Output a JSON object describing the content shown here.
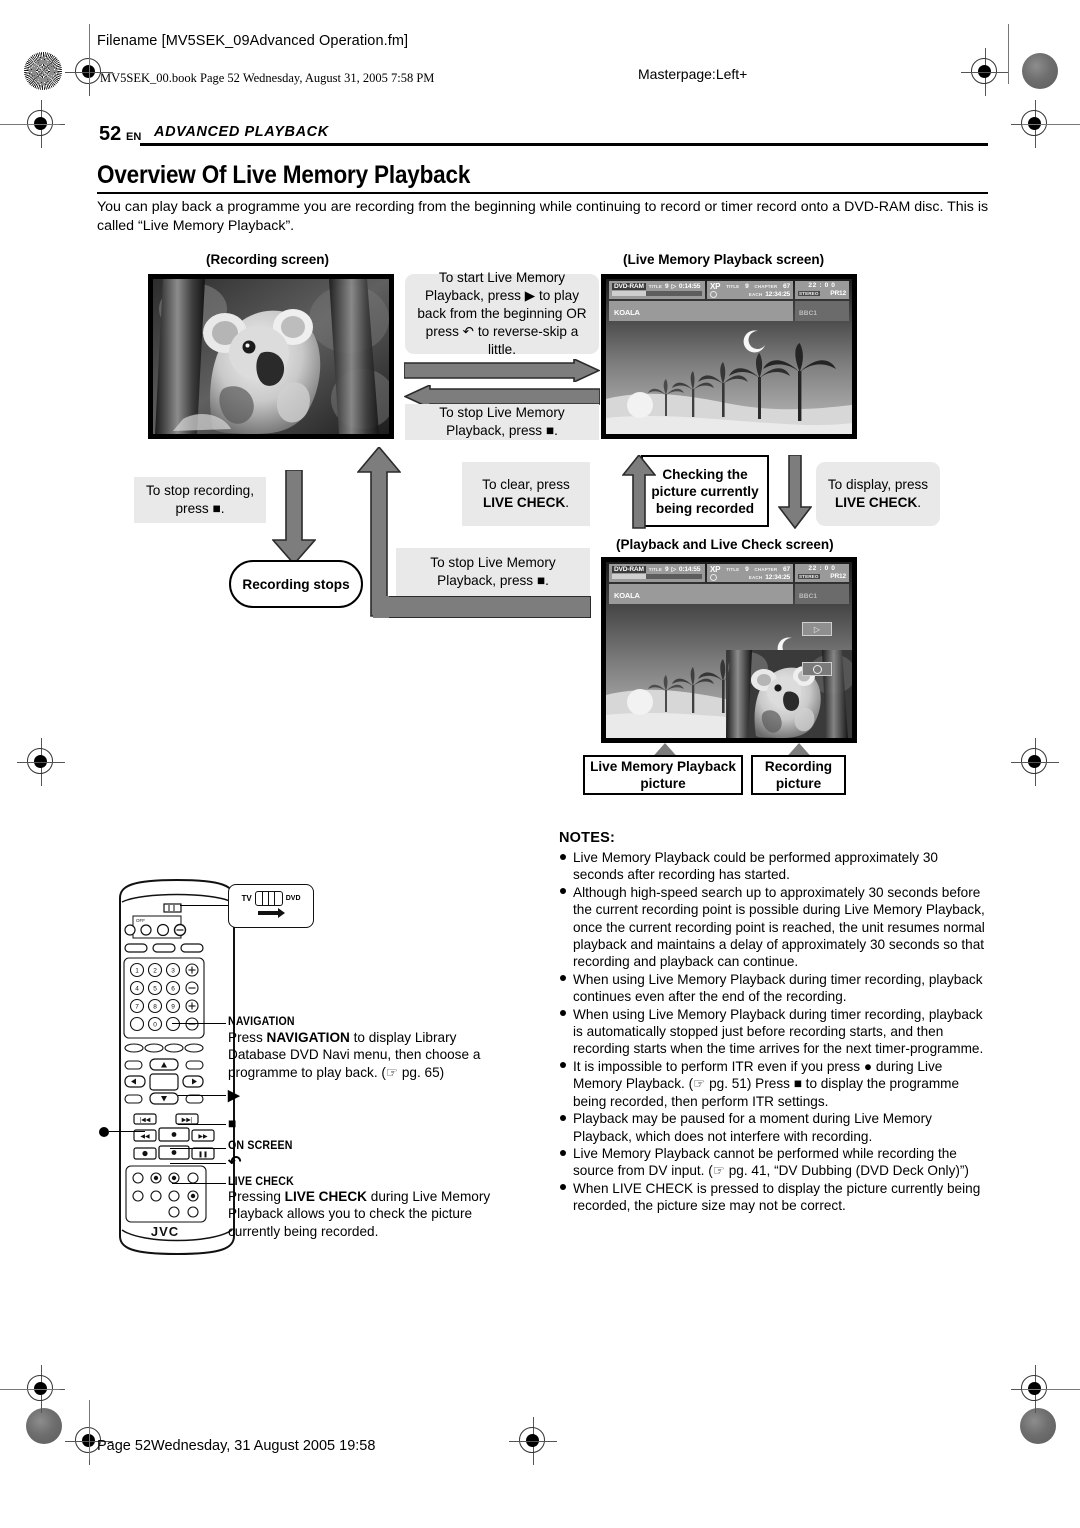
{
  "header": {
    "filename": "Filename [MV5SEK_09Advanced Operation.fm]",
    "bookline": "MV5SEK_00.book  Page 52  Wednesday, August 31, 2005  7:58 PM",
    "masterpage": "Masterpage:Left+"
  },
  "running_head": {
    "page_number": "52",
    "lang": "EN",
    "section": "ADVANCED PLAYBACK"
  },
  "title": "Overview Of Live Memory Playback",
  "intro": "You can play back a programme you are recording from the beginning while continuing to record or timer record onto a DVD-RAM disc. This is called “Live Memory Playback”.",
  "diagram": {
    "recording_screen_caption": "(Recording screen)",
    "live_memory_caption": "(Live Memory Playback screen)",
    "playback_livecheck_caption": "(Playback and Live Check screen)",
    "box_start": "To start Live Memory Playback, press ▶ to play back from the beginning OR press ↶ to reverse-skip a little.",
    "box_stop_lmp_top": "To stop Live Memory Playback, press ■.",
    "box_stop_recording": "To stop recording, press ■.",
    "box_recording_stops": "Recording stops",
    "box_stop_lmp_bottom": "To stop Live Memory Playback, press ■.",
    "box_clear": "To clear, press",
    "box_clear_bold": "LIVE CHECK",
    "box_clear_tail": ".",
    "box_checking": "Checking the picture currently being recorded",
    "box_display": "To display, press",
    "box_display_bold": "LIVE CHECK",
    "box_display_tail": ".",
    "label_lmp_picture": "Live Memory Playback picture",
    "label_recording_picture": "Recording picture"
  },
  "osd": {
    "disc": "DVD-RAM",
    "title_label": "TITLE",
    "title_value": "9",
    "time_elapsed": "0:14:55",
    "rec_mode": "XP",
    "title2_label": "TITLE",
    "title2_value": "9",
    "chapter_label": "CHAPTER",
    "chapter_value": "67",
    "each_label": "EACH",
    "each_value": "12:34:25",
    "clock": "22 : 0 0",
    "audio": "STEREO",
    "programme": "PR12",
    "disc_name": "KOALA",
    "channel": "BBC1"
  },
  "notes": {
    "heading": "NOTES:",
    "items": [
      "Live Memory Playback could be performed approximately 30 seconds after recording has started.",
      "Although high-speed search up to approximately 30 seconds before the current recording point is possible during Live Memory Playback, once the current recording point is reached, the unit resumes normal playback and maintains a delay of approximately 30 seconds so that recording and playback can continue.",
      "When using Live Memory Playback during timer recording, playback continues even after the end of the recording.",
      "When using Live Memory Playback during timer recording, playback is automatically stopped just before recording starts, and then recording starts when the time arrives for the next timer-programme.",
      "It is impossible to perform ITR even if you press ● during Live Memory Playback. (☞ pg. 51) Press ■ to display the programme being recorded, then perform ITR settings.",
      "Playback may be paused for a moment during Live Memory Playback, which does not interfere with recording.",
      "Live Memory Playback cannot be performed while recording the source from DV input. (☞ pg. 41, “DV Dubbing (DVD Deck Only)”)",
      "When LIVE CHECK is pressed to display the picture currently being recorded, the picture size may not be correct."
    ]
  },
  "remote": {
    "brand": "JVC",
    "tv_label": "TV",
    "dvd_label": "DVD",
    "off_label": "OFF",
    "keypad": [
      "1",
      "2",
      "3",
      "4",
      "5",
      "6",
      "7",
      "8",
      "9",
      "0"
    ],
    "navigation_title": "NAVIGATION",
    "navigation_text": "Press NAVIGATION to display Library Database DVD Navi menu, then choose a programme to play back. (☞ pg. 65)",
    "play_label": "▶",
    "stop_label": "■",
    "onscreen_title": "ON SCREEN",
    "reverse_skip_label": "↶",
    "livecheck_title": "LIVE CHECK",
    "livecheck_text": "Pressing LIVE CHECK during Live Memory Playback allows you to check the picture currently being recorded.",
    "record_dot": "●"
  },
  "footer": "Page 52Wednesday, 31 August 2005  19:58",
  "colors": {
    "arrow_grey": "#7d7d7d",
    "box_grey": "#e9e9e9",
    "osd_grey": "#9a9a9a"
  }
}
